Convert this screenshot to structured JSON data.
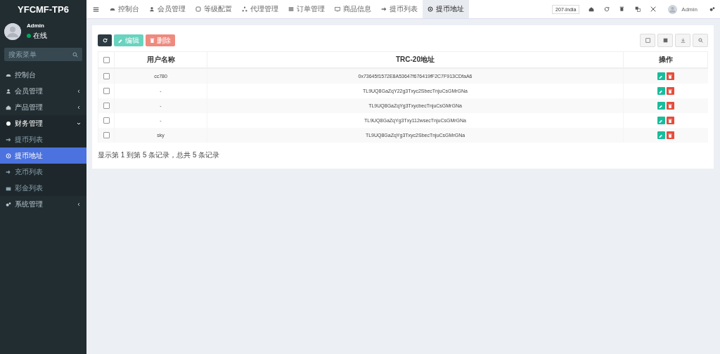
{
  "sidebar": {
    "logo": "YFCMF-TP6",
    "user": {
      "name": "Admin",
      "status": "在线"
    },
    "search": {
      "placeholder": "搜索菜单"
    },
    "items": [
      {
        "label": "控制台",
        "kind": "link"
      },
      {
        "label": "会员管理",
        "kind": "group",
        "expanded": false
      },
      {
        "label": "产品管理",
        "kind": "group",
        "expanded": false
      },
      {
        "label": "财务管理",
        "kind": "group",
        "expanded": true,
        "children": [
          {
            "label": "提币列表",
            "selected": false
          },
          {
            "label": "提币地址",
            "selected": true
          },
          {
            "label": "充币列表",
            "selected": false
          },
          {
            "label": "彩金列表",
            "selected": false
          }
        ]
      },
      {
        "label": "系统管理",
        "kind": "group",
        "expanded": false
      }
    ]
  },
  "tabs": [
    {
      "label": "控制台",
      "selected": false
    },
    {
      "label": "会员管理",
      "selected": false
    },
    {
      "label": "等级配置",
      "selected": false
    },
    {
      "label": "代理管理",
      "selected": false
    },
    {
      "label": "订单管理",
      "selected": false
    },
    {
      "label": "商品信息",
      "selected": false
    },
    {
      "label": "提币列表",
      "selected": false
    },
    {
      "label": "提币地址",
      "selected": true
    }
  ],
  "header": {
    "language": "207-India",
    "user": "Admin"
  },
  "toolbar": {
    "edit": "编辑",
    "delete": "删除"
  },
  "table": {
    "all_checked": false,
    "columns": [
      "用户名称",
      "TRC-20地址",
      "操作"
    ],
    "rows": [
      {
        "username": "cc780",
        "address": "0x73645f1572E8A53647f676419fF2C7F913CDfaA6",
        "checked": false
      },
      {
        "username": "-",
        "address": "TL9UQ8GaZqY22g3Txyc2SbecTnjuCsGMrGNa",
        "checked": false
      },
      {
        "username": "-",
        "address": "TL9UQ8GaZqYg3TxycbecTnjuCsGMrGNa",
        "checked": false
      },
      {
        "username": "-",
        "address": "TL9UQ8GaZqYg3Txy112wsecTnjuCsGMrGNa",
        "checked": false
      },
      {
        "username": "sky",
        "address": "TL9UQ8GaZqYg3Txyc2SbecTnjuCsGMrGNa",
        "checked": false
      }
    ]
  },
  "pagination": {
    "summary": "显示第 1 到第 5 条记录，总共 5 条记录"
  }
}
